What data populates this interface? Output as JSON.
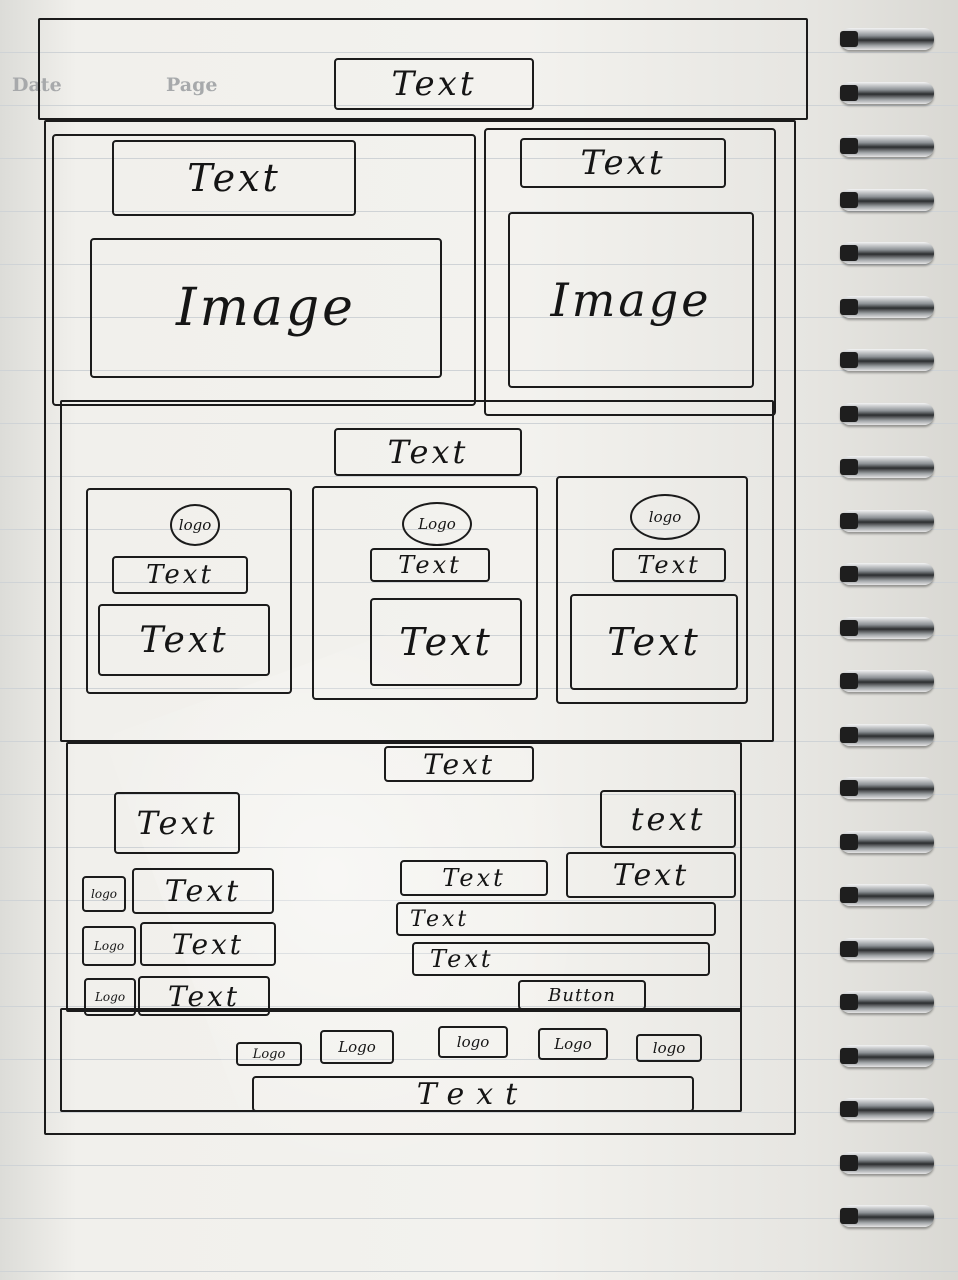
{
  "paper": {
    "printed_date": "Date",
    "printed_page": "Page"
  },
  "header": {
    "text": "Text"
  },
  "hero": {
    "left": {
      "text": "Text",
      "image": "Image"
    },
    "right": {
      "text": "Text",
      "image": "Image"
    }
  },
  "features": {
    "title": "Text",
    "cards": [
      {
        "logo": "logo",
        "heading": "Text",
        "body": "Text"
      },
      {
        "logo": "Logo",
        "heading": "Text",
        "body": "Text"
      },
      {
        "logo": "logo",
        "heading": "Text",
        "body": "Text"
      }
    ]
  },
  "contact": {
    "title": "Text",
    "left_heading": "Text",
    "left_items": [
      {
        "logo": "logo",
        "text": "Text"
      },
      {
        "logo": "Logo",
        "text": "Text"
      },
      {
        "logo": "Logo",
        "text": "Text"
      }
    ],
    "right_heading": "text",
    "form": {
      "field_a": "Text",
      "field_b": "Text",
      "field_c": "Text",
      "field_d": "Text",
      "button": "Button"
    }
  },
  "footer": {
    "logos": [
      "Logo",
      "Logo",
      "logo",
      "Logo",
      "logo"
    ],
    "text": "Text"
  },
  "colors": {
    "ink": "#1b1b1b",
    "paper": "#f3f2ee",
    "rule": "#cfd3d6"
  }
}
